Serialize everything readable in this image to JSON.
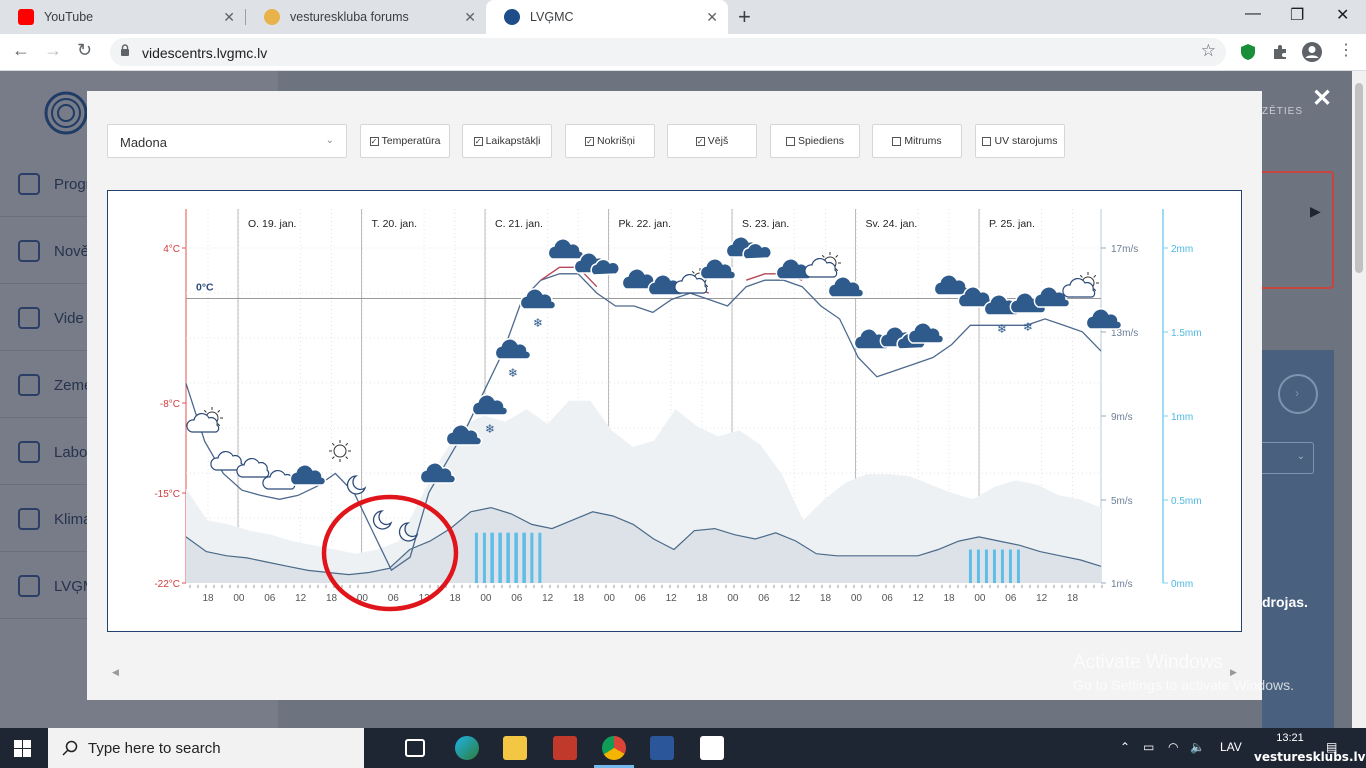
{
  "browser": {
    "tabs": [
      {
        "title": "YouTube",
        "icon": "youtube-icon",
        "color": "#ff0000"
      },
      {
        "title": "vestureskluba forums",
        "icon": "forum-icon",
        "color": "#b8860b"
      },
      {
        "title": "LVĢMC",
        "icon": "lvgmc-icon",
        "color": "#1d4e89"
      }
    ],
    "url": "videscentrs.lvgmc.lv"
  },
  "site": {
    "sidebar": [
      "Progr",
      "Nově",
      "Vide",
      "Zeme",
      "Labo",
      "Klima",
      "LVĢM"
    ],
    "header_fragment": "ZĒTIES",
    "right_fragment": "drojas."
  },
  "modal": {
    "location": "Madona",
    "toggles": [
      {
        "label": "Temperatūra",
        "checked": true
      },
      {
        "label": "Laikapstākļi",
        "checked": true
      },
      {
        "label": "Nokrišņi",
        "checked": true
      },
      {
        "label": "Vējš",
        "checked": true
      },
      {
        "label": "Spiediens",
        "checked": false
      },
      {
        "label": "Mitrums",
        "checked": false
      },
      {
        "label": "UV starojums",
        "checked": false
      }
    ]
  },
  "chart_data": {
    "type": "line",
    "days": [
      "O. 19. jan.",
      "T. 20. jan.",
      "C. 21. jan.",
      "Pk. 22. jan.",
      "S. 23. jan.",
      "Sv. 24. jan.",
      "P. 25. jan."
    ],
    "hour_ticks": [
      "18",
      "00",
      "06",
      "12",
      "18",
      "00",
      "06",
      "12",
      "18",
      "00",
      "06",
      "12",
      "18",
      "00",
      "06",
      "12",
      "18",
      "00",
      "06",
      "12",
      "18",
      "00",
      "06",
      "12",
      "18",
      "00",
      "06",
      "12",
      "18"
    ],
    "temp_axis": {
      "labels": [
        "4°C",
        "-8°C",
        "-15°C",
        "-22°C"
      ],
      "values": [
        4,
        -8,
        -15,
        -22
      ],
      "zero_label": "0°C"
    },
    "wind_axis": {
      "labels": [
        "17m/s",
        "13m/s",
        "9m/s",
        "5m/s",
        "1m/s"
      ],
      "values": [
        17,
        13,
        9,
        5,
        1
      ]
    },
    "precip_axis": {
      "labels": [
        "2mm",
        "1.5mm",
        "1mm",
        "0.5mm",
        "0mm"
      ],
      "values": [
        2,
        1.5,
        1,
        0.5,
        0
      ]
    },
    "temperature": [
      -6.5,
      -11,
      -13.5,
      -14.8,
      -15.2,
      -15.5,
      -15.2,
      -14.5,
      -13.5,
      -15,
      -18,
      -21,
      -20,
      -15,
      -12.5,
      -10,
      -7,
      -4,
      0,
      1.5,
      2.5,
      2.5,
      1,
      0,
      0,
      -0.5,
      0.5,
      1,
      0.5,
      0,
      1.5,
      2,
      2,
      1.5,
      0,
      -1,
      -4,
      -5.5,
      -5,
      -4.5,
      -4,
      -3,
      -1.5,
      -1.5,
      -1.5,
      -1.5,
      -1,
      -1.5,
      -2,
      -3.5
    ],
    "temperature_dew": [
      -6.5,
      -11,
      -13.5,
      -14.8,
      -15.2,
      -15.5,
      -15.2,
      -14.5,
      -13.5,
      -15,
      -18,
      -21,
      -20,
      -15,
      -12.5,
      -10,
      -7,
      -4,
      0,
      1.5,
      2,
      2,
      0.5,
      -0.5,
      -0.5,
      -1,
      0,
      0.5,
      0,
      -0.5,
      1,
      1.5,
      1.5,
      1,
      -0.5,
      -1.5,
      -4.5,
      -6,
      -5.5,
      -5,
      -4.5,
      -3.5,
      -2,
      -2,
      -2,
      -2,
      -1.5,
      -2,
      -2.5,
      -4
    ],
    "wind_speed": [
      3.2,
      2.5,
      2.3,
      2.2,
      2,
      1.8,
      1.6,
      1.5,
      1.4,
      1.5,
      1.7,
      2.6,
      3,
      3.6,
      4.4,
      4.6,
      4.3,
      3.8,
      3.6,
      4,
      4.4,
      4.2,
      3.8,
      3.1,
      2.6,
      3.5,
      3.6,
      3.3,
      3.1,
      3.4,
      3,
      2.4,
      2.3,
      2.3,
      2.3,
      2.3,
      2.3,
      2.6,
      3,
      3.2,
      3,
      2.8,
      2.5,
      2.3,
      2.1,
      1.8
    ],
    "wind_gust": [
      5.5,
      4,
      3.8,
      3.5,
      3.3,
      3,
      2.8,
      2.6,
      2.4,
      2.6,
      3,
      5,
      7,
      8.5,
      9,
      8.7,
      9.3,
      8.6,
      9.7,
      9.7,
      8.3,
      7.5,
      7.8,
      9.3,
      8.5,
      8,
      8.3,
      7.6,
      6.2,
      4,
      5,
      5.8,
      6.2,
      6.2,
      6.1,
      5.7,
      5.3,
      5,
      5.6,
      5.9,
      5.7,
      5.2,
      5,
      4.6
    ],
    "precipitation_mm": [
      {
        "hour": "03",
        "day": "C. 21. jan.",
        "value": 0.3
      },
      {
        "hour": "06",
        "day": "C. 21. jan.",
        "value": 0.3
      },
      {
        "hour": "03",
        "day": "P. 25. jan.",
        "value": 0.2
      }
    ]
  }
}
